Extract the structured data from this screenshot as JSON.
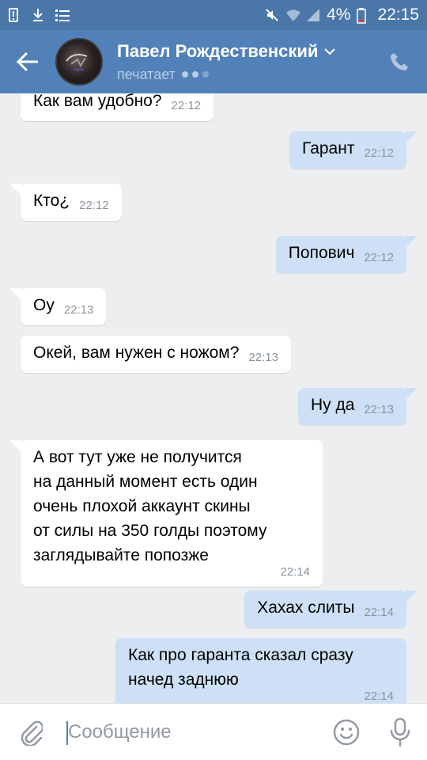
{
  "status_bar": {
    "battery": "4%",
    "time": "22:15"
  },
  "header": {
    "contact_name": "Павел Рождественский",
    "status": "печатает"
  },
  "messages": [
    {
      "dir": "in",
      "text": "Как вам удобно?",
      "time": "22:12"
    },
    {
      "dir": "out",
      "text": "Гарант",
      "time": "22:12"
    },
    {
      "dir": "in",
      "text": "Кто¿",
      "time": "22:12"
    },
    {
      "dir": "out",
      "text": "Попович",
      "time": "22:12"
    },
    {
      "dir": "in",
      "text": "Оу",
      "time": "22:13"
    },
    {
      "dir": "in",
      "text": "Окей, вам нужен с ножом?",
      "time": "22:13"
    },
    {
      "dir": "out",
      "text": "Ну да",
      "time": "22:13"
    },
    {
      "dir": "in",
      "text": "А вот тут уже не получится\nна данный момент есть один\nочень плохой аккаунт скины\nот силы на 350 голды поэтому\nзаглядывайте попозже",
      "time": "22:14"
    },
    {
      "dir": "out",
      "text": "Хахах слиты",
      "time": "22:14"
    },
    {
      "dir": "out",
      "text": "Как про гаранта сказал сразу\nначед заднюю",
      "time": "22:14"
    }
  ],
  "input": {
    "placeholder": "Сообщение"
  },
  "colors": {
    "header": "#5181b8",
    "status_bar": "#4a76a8",
    "incoming_bubble": "#ffffff",
    "outgoing_bubble": "#cde0f5",
    "background": "#edeef0"
  },
  "icons": {
    "back": "arrow-left-icon",
    "call": "phone-icon",
    "attach": "paperclip-icon",
    "emoji": "smile-icon",
    "voice": "microphone-icon"
  }
}
